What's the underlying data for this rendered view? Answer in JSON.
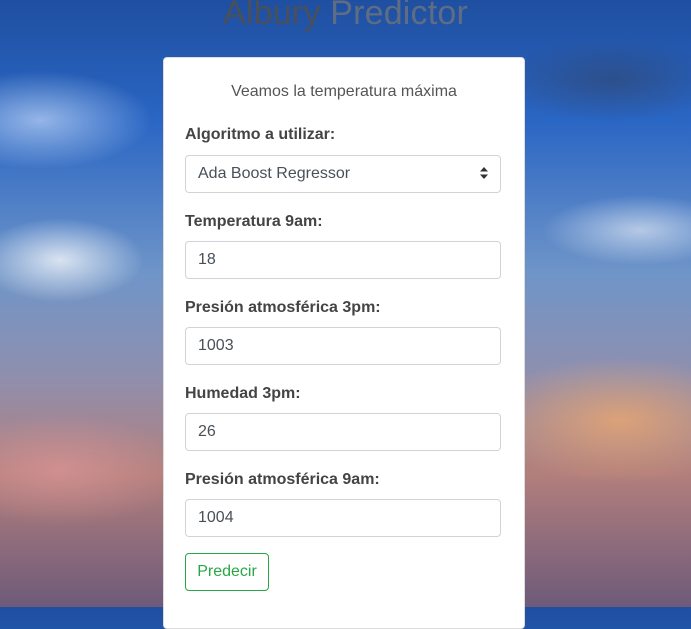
{
  "header": {
    "title_part1": "Albury",
    "title_part2": "Predictor"
  },
  "card": {
    "subtitle": "Veamos la temperatura máxima",
    "fields": [
      {
        "label": "Algoritmo a utilizar:",
        "value": "Ada Boost Regressor"
      },
      {
        "label": "Temperatura 9am:",
        "value": "18"
      },
      {
        "label": "Presión atmosférica 3pm:",
        "value": "1003"
      },
      {
        "label": "Humedad 3pm:",
        "value": "26"
      },
      {
        "label": "Presión atmosférica 9am:",
        "value": "1004"
      }
    ],
    "submit_label": "Predecir"
  },
  "colors": {
    "accent": "#28a745",
    "label_text": "#444444",
    "field_border": "#ced4da"
  },
  "icons": {
    "select_arrows": "up-down-chevron-icon"
  }
}
